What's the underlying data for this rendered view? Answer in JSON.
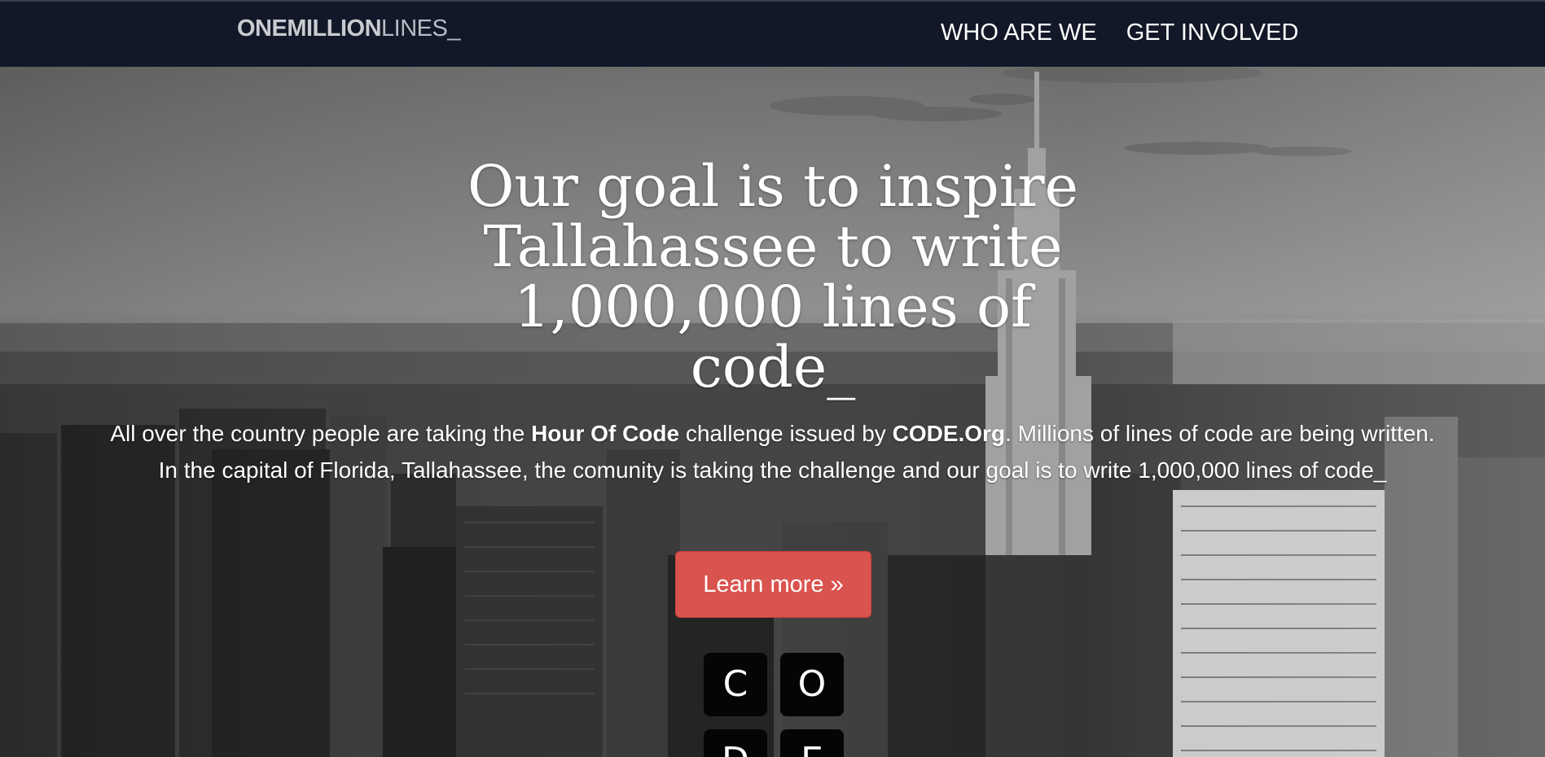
{
  "nav": {
    "brand_bold": "ONEMILLION",
    "brand_light": "LINES_",
    "links": [
      "WHO ARE WE",
      "GET INVOLVED"
    ]
  },
  "hero": {
    "headline_lines": [
      "Our goal is to inspire",
      "Tallahassee to write",
      "1,000,000 lines of",
      "code_"
    ],
    "lead": {
      "part1": "All over the country people are taking the ",
      "bold1": "Hour Of Code",
      "part2": " challenge issued by ",
      "bold2": "CODE.Org",
      "part3": ". Millions of lines of code are being written. In the capital of Florida, Tallahassee, the comunity is taking the challenge and our goal is to write 1,000,000 lines of code_"
    },
    "button_label": "Learn more »",
    "tiles": [
      "C",
      "O",
      "D",
      "E"
    ]
  },
  "colors": {
    "navbar_bg": "#121828",
    "button_bg": "#d9534f",
    "tile_bg": "#050505"
  },
  "background_image": "black-and-white aerial city skyline"
}
